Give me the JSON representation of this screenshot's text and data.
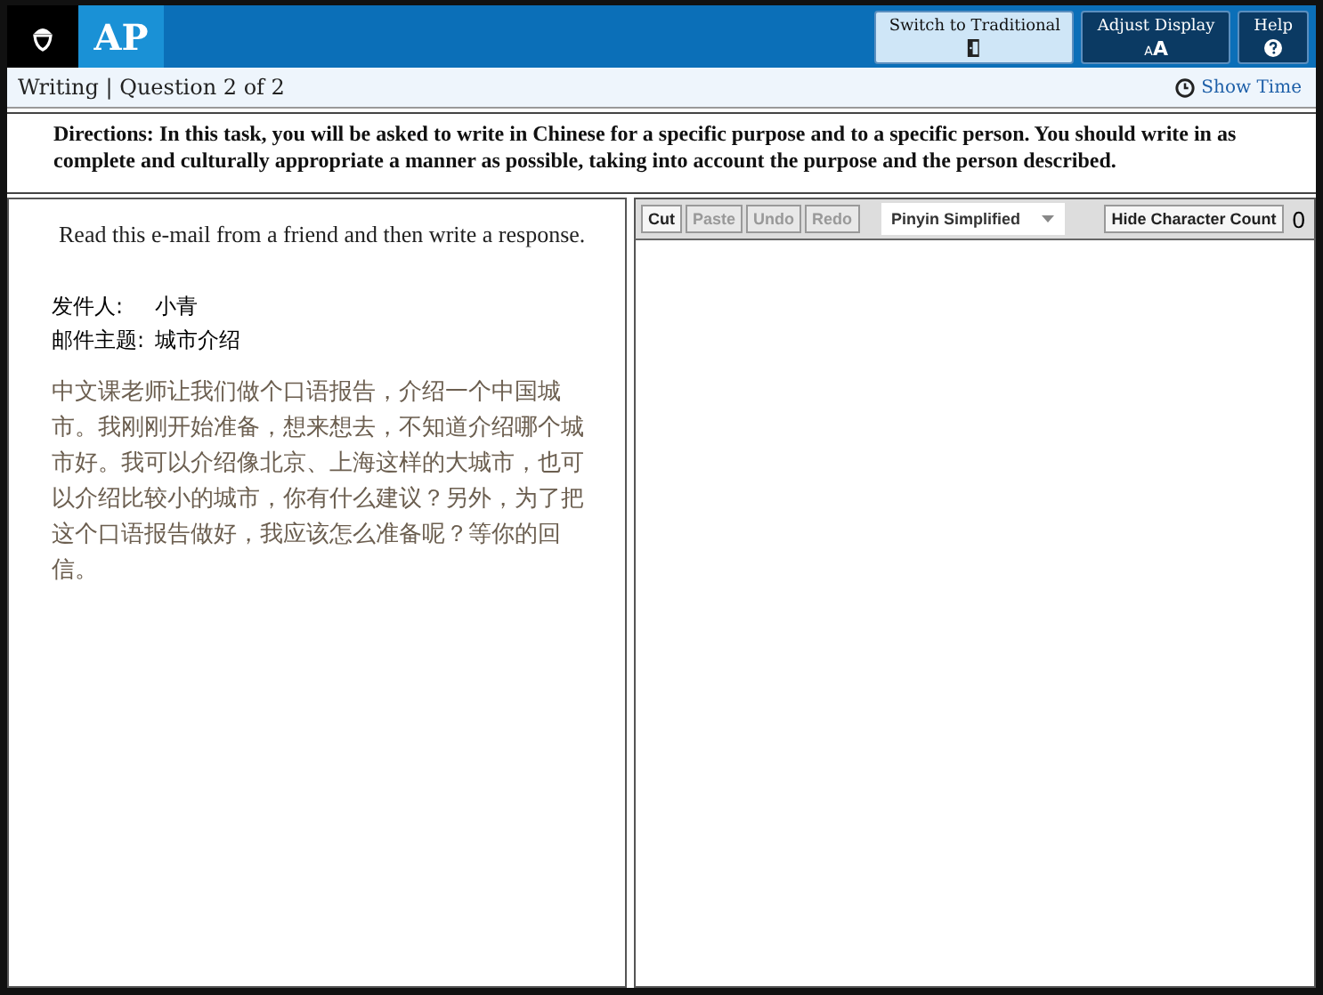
{
  "header": {
    "logo": "AP",
    "buttons": [
      {
        "label": "Switch to Traditional",
        "kind": "door",
        "highlighted": true
      },
      {
        "label": "Adjust Display",
        "kind": "font",
        "highlighted": false,
        "icon_text": "AA"
      },
      {
        "label": "Help",
        "kind": "help",
        "highlighted": false
      }
    ]
  },
  "subbar": {
    "title": "Writing | Question 2 of 2",
    "timer_link": "Show Time"
  },
  "directions": "**Directions:** In this task, you will be asked to write in Chinese for a specific purpose and to a specific person. You should write in as complete and culturally appropriate a manner as possible, taking into account the purpose and the person described.",
  "prompt": {
    "instruction": "Read this e-mail from a friend and then write a response.",
    "fields": [
      {
        "label": "发件人:",
        "value": "小青"
      },
      {
        "label": "邮件主题:",
        "value": "城市介绍"
      }
    ],
    "body": "中文课老师让我们做个口语报告，介绍一个中国城市。我刚刚开始准备，想来想去，不知道介绍哪个城市好。我可以介绍像北京、上海这样的大城市，也可以介绍比较小的城市，你有什么建议？另外，为了把这个口语报告做好，我应该怎么准备呢？等你的回信。"
  },
  "editor": {
    "tools": [
      {
        "label": "Cut",
        "disabled": false
      },
      {
        "label": "Paste",
        "disabled": true
      },
      {
        "label": "Undo",
        "disabled": true
      },
      {
        "label": "Redo",
        "disabled": true
      }
    ],
    "input_method": "Pinyin Simplified",
    "count_button": "Hide Character Count",
    "char_count": "0"
  }
}
